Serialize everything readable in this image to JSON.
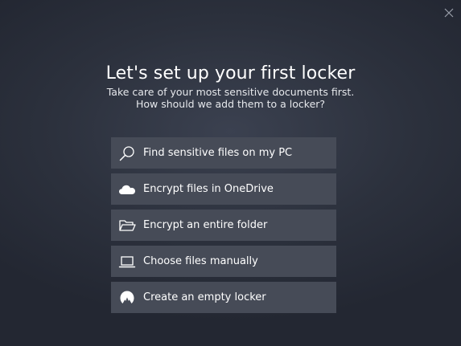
{
  "dialog": {
    "close_icon": "close-icon",
    "title": "Let's set up your first locker",
    "subtitle_line1": "Take care of your most sensitive documents first.",
    "subtitle_line2": "How should we add them to a locker?"
  },
  "options": [
    {
      "label": "Find sensitive files on my PC",
      "icon": "search-icon"
    },
    {
      "label": "Encrypt files in OneDrive",
      "icon": "cloud-icon"
    },
    {
      "label": "Encrypt an entire folder",
      "icon": "folder-icon"
    },
    {
      "label": "Choose files manually",
      "icon": "laptop-icon"
    },
    {
      "label": "Create an empty locker",
      "icon": "nordlocker-logo-icon"
    }
  ],
  "colors": {
    "background": "#2c313d",
    "option_background": "#464b57",
    "text": "#ffffff"
  }
}
